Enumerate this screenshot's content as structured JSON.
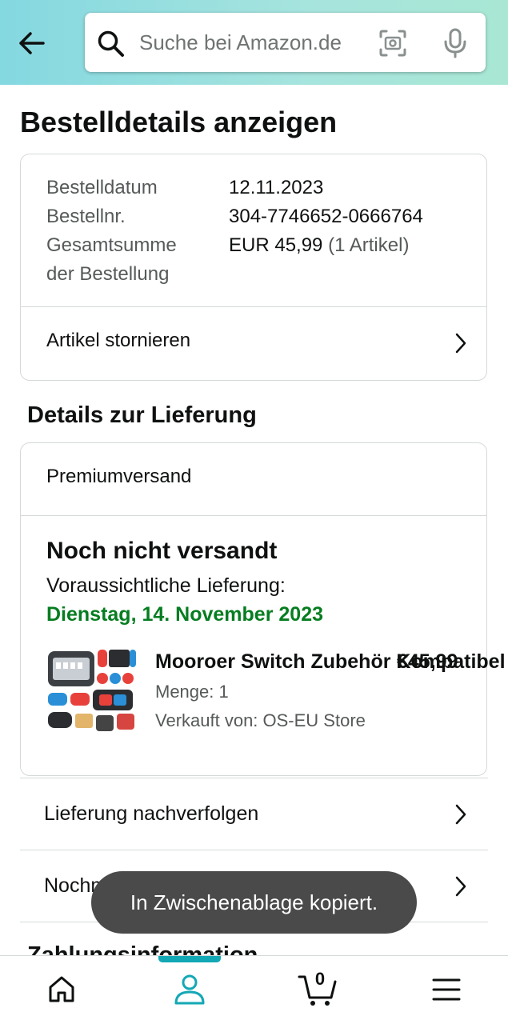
{
  "header": {
    "search_placeholder": "Suche bei Amazon.de"
  },
  "page": {
    "title": "Bestelldetails anzeigen"
  },
  "order_summary": {
    "date_label": "Bestelldatum",
    "date_value": "12.11.2023",
    "number_label": "Bestellnr.",
    "number_value": "304-7746652-0666764",
    "total_label_1": "Gesamtsumme",
    "total_label_2": "der Bestellung",
    "total_value": "EUR 45,99",
    "total_items": "(1 Artikel)",
    "cancel_label": "Artikel stornieren"
  },
  "delivery": {
    "section_title": "Details zur Lieferung",
    "shipping_method": "Premiumversand",
    "status": "Noch nicht versandt",
    "eta_label": "Voraussichtliche Lieferung:",
    "eta_date": "Dienstag, 14. November 2023",
    "product": {
      "title": "Mooroer Switch Zubehör Kompatibel",
      "price": "€45,99",
      "quantity": "Menge: 1",
      "seller": "Verkauft von: OS-EU Store"
    }
  },
  "actions": {
    "track_label": "Lieferung nachverfolgen",
    "buy_again_label": "Nochmals kaufen"
  },
  "payment": {
    "section_title_partial": "Zahlungsinformation"
  },
  "toast": {
    "message": "In Zwischenablage kopiert."
  },
  "bottom_nav": {
    "cart_count": "0",
    "active": "account"
  },
  "colors": {
    "header_gradient_start": "#84d8e0",
    "header_gradient_end": "#a9e7d4",
    "eta_green": "#067d20",
    "nav_active": "#13a8b5"
  }
}
